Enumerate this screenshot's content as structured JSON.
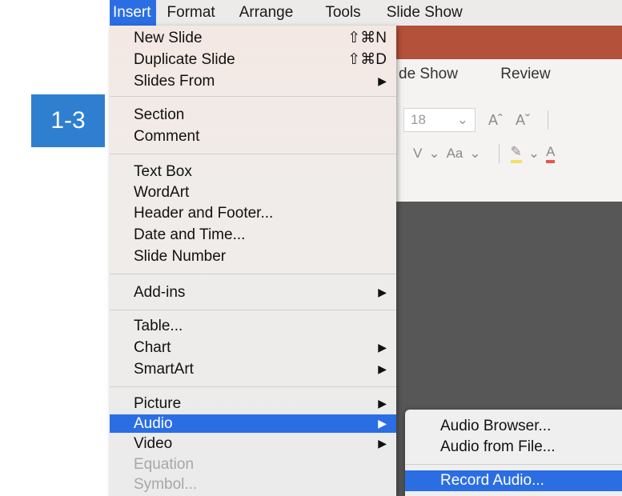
{
  "step_badge": "1-3",
  "menubar": {
    "items": [
      "Insert",
      "Format",
      "Arrange",
      "Tools",
      "Slide Show"
    ]
  },
  "ppt_window": {
    "tabs": [
      "de Show",
      "Review"
    ],
    "font_size": "18",
    "font_size_chevron": "⌄",
    "grow_font": "Aˆ",
    "shrink_font": "Aˇ",
    "text_effects": "V",
    "change_case": "Aa",
    "chevron": "⌄",
    "font_color": "A",
    "highlighter": "✎"
  },
  "insert_menu": {
    "new_slide": {
      "label": "New Slide",
      "shortcut": "⇧⌘N"
    },
    "duplicate_slide": {
      "label": "Duplicate Slide",
      "shortcut": "⇧⌘D"
    },
    "slides_from": {
      "label": "Slides From"
    },
    "section": {
      "label": "Section"
    },
    "comment": {
      "label": "Comment"
    },
    "text_box": {
      "label": "Text Box"
    },
    "wordart": {
      "label": "WordArt"
    },
    "header_footer": {
      "label": "Header and Footer..."
    },
    "date_time": {
      "label": "Date and Time..."
    },
    "slide_number": {
      "label": "Slide Number"
    },
    "add_ins": {
      "label": "Add-ins"
    },
    "table": {
      "label": "Table..."
    },
    "chart": {
      "label": "Chart"
    },
    "smartart": {
      "label": "SmartArt"
    },
    "picture": {
      "label": "Picture"
    },
    "audio": {
      "label": "Audio"
    },
    "video": {
      "label": "Video"
    },
    "equation": {
      "label": "Equation"
    },
    "symbol": {
      "label": "Symbol..."
    },
    "submenu_arrow": "▶"
  },
  "audio_submenu": {
    "items": [
      "Audio Browser...",
      "Audio from File...",
      "Record Audio..."
    ]
  }
}
